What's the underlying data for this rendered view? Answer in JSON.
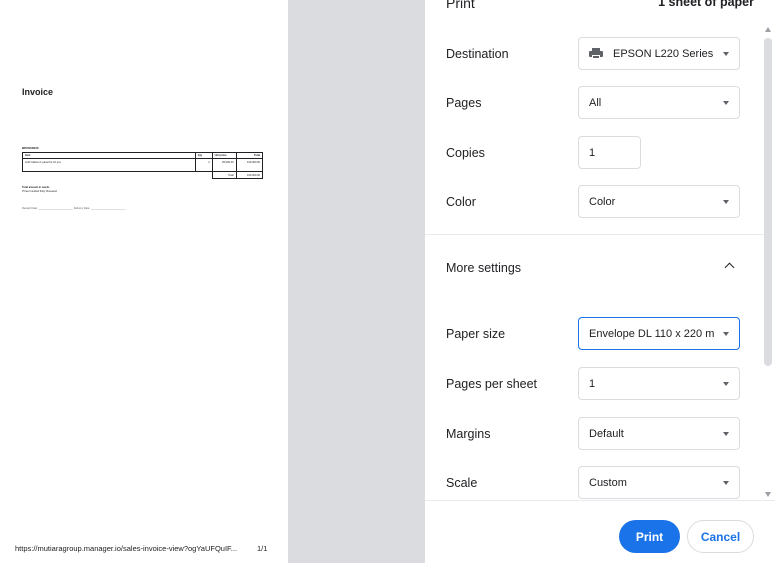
{
  "preview": {
    "invoice_title": "Invoice",
    "invoice_ref": "BPO006230",
    "table": {
      "headers": [
        "Item",
        "Qty",
        "Unit price",
        "Total"
      ],
      "row": [
        "Gulf Cabinet 1 panel for 10 pcs",
        "4",
        "25,000.00",
        "100,000.00"
      ],
      "total_label": "Total",
      "total_value": "100,000.00"
    },
    "words_label": "Total amount in words",
    "words_value": "Three hundred thirty thousand",
    "sign_line": "Receipt Date: ________________________  Delivery Date: ________________________",
    "footer_url": "https://mutiaragroup.manager.io/sales-invoice-view?ogYaUFQuIF...",
    "footer_page": "1/1"
  },
  "panel": {
    "title": "Print",
    "sheet_count": "1 sheet of paper",
    "destination": {
      "label": "Destination",
      "value": "EPSON L220 Series",
      "icon": "printer-icon"
    },
    "pages": {
      "label": "Pages",
      "value": "All"
    },
    "copies": {
      "label": "Copies",
      "value": "1"
    },
    "color": {
      "label": "Color",
      "value": "Color"
    },
    "more_settings": {
      "label": "More settings",
      "icon": "chevron-up-icon"
    },
    "paper_size": {
      "label": "Paper size",
      "value": "Envelope DL 110 x 220 m"
    },
    "pages_per_sheet": {
      "label": "Pages per sheet",
      "value": "1"
    },
    "margins": {
      "label": "Margins",
      "value": "Default"
    },
    "scale": {
      "label": "Scale",
      "value": "Custom"
    },
    "print_button": "Print",
    "cancel_button": "Cancel"
  },
  "colors": {
    "accent": "#1a73e8",
    "gap_gray": "#dadce0",
    "text": "#202124"
  }
}
